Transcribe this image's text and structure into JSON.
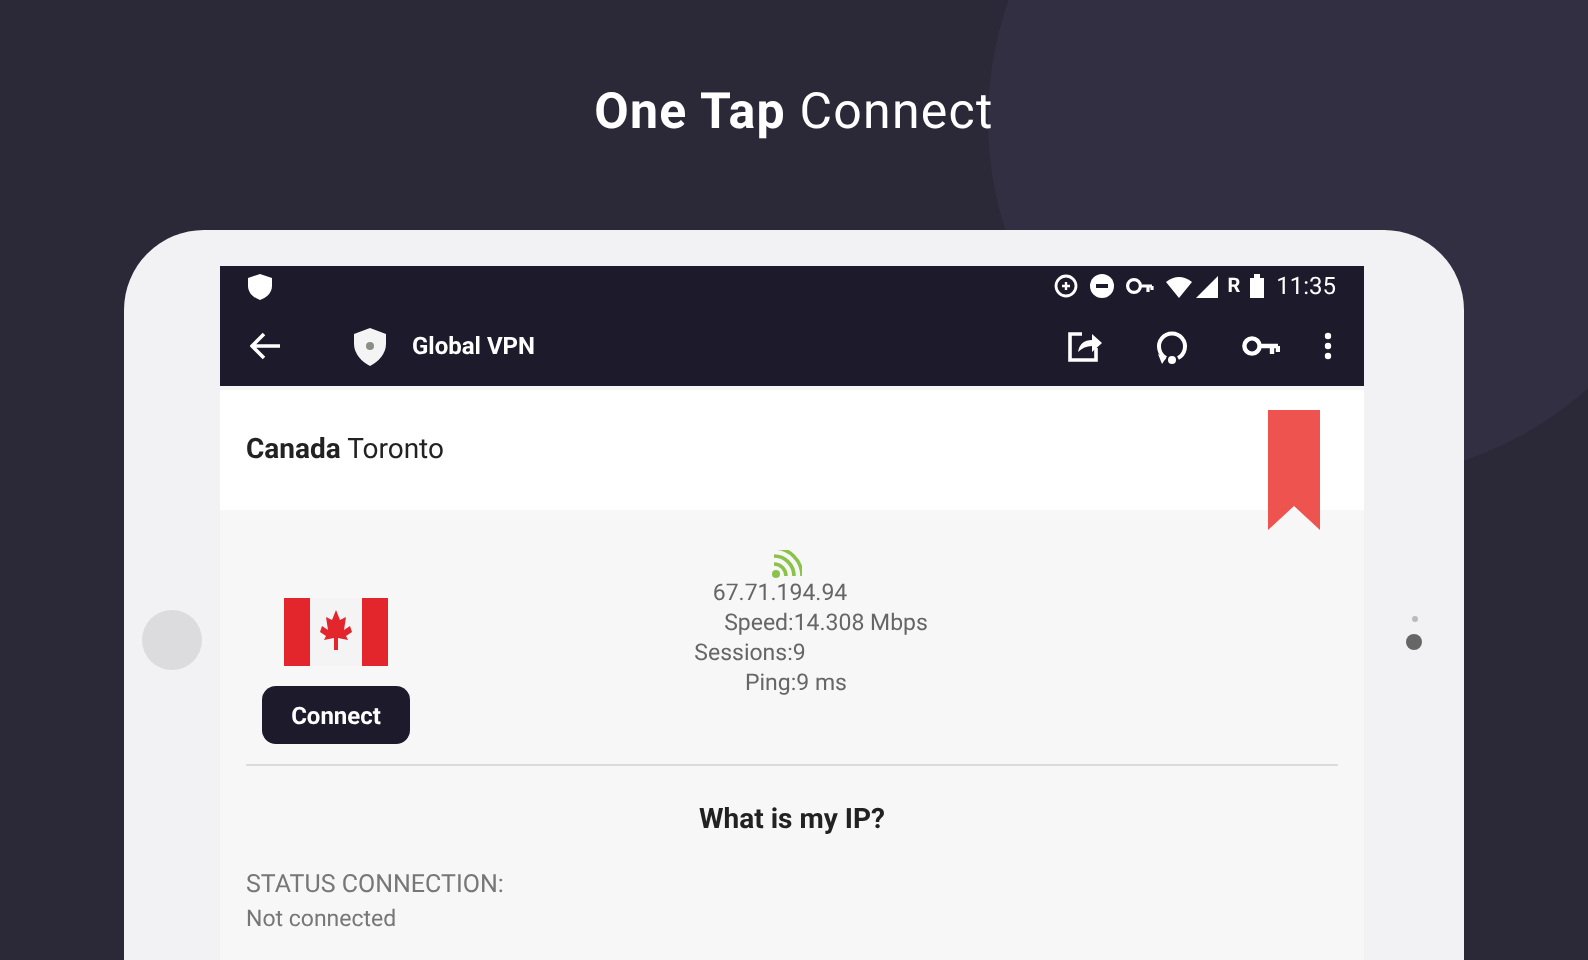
{
  "headline": "**One Tap** Connect",
  "status_bar": {
    "network_label": "R",
    "time": "11:35"
  },
  "toolbar": {
    "title": "Global VPN"
  },
  "location": {
    "text": "**Canada** Toronto"
  },
  "server": {
    "ip": "67.71.194.94",
    "speed": "Speed:14.308 Mbps",
    "sessions": "Sessions:9",
    "ping": "Ping:9 ms"
  },
  "connect_button": "Connect",
  "ip_heading": "What is my IP?",
  "status": {
    "label": "STATUS CONNECTION:",
    "value": "Not connected"
  }
}
